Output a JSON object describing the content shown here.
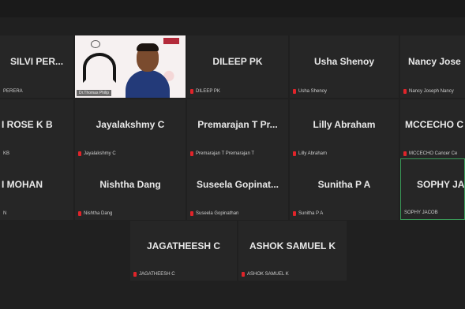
{
  "meeting": {
    "participants": [
      {
        "id": "silvi",
        "name": "SILVI PER...",
        "label": "PERERA"
      },
      {
        "id": "presenter",
        "name": "",
        "label": "Dr.Thomas Philip"
      },
      {
        "id": "dileep",
        "name": "DILEEP PK",
        "label": "DILEEP PK"
      },
      {
        "id": "usha",
        "name": "Usha Shenoy",
        "label": "Usha Shenoy"
      },
      {
        "id": "nancy",
        "name": "Nancy Jose",
        "label": "Nancy Joseph Nancy"
      },
      {
        "id": "rose",
        "name": "I ROSE K B",
        "label": "KB"
      },
      {
        "id": "jaya",
        "name": "Jayalakshmy C",
        "label": "Jayalakshmy C"
      },
      {
        "id": "prema",
        "name": "Premarajan T Pr...",
        "label": "Premarajan T Premarajan T"
      },
      {
        "id": "lilly",
        "name": "Lilly Abraham",
        "label": "Lilly Abraham"
      },
      {
        "id": "mccecho",
        "name": "MCCECHO C",
        "label": "MCCECHO Cancer Ce"
      },
      {
        "id": "mohan",
        "name": "I MOHAN",
        "label": "N"
      },
      {
        "id": "nishtha",
        "name": "Nishtha Dang",
        "label": "Nishtha Dang"
      },
      {
        "id": "suseela",
        "name": "Suseela  Gopinat...",
        "label": "Suseela Gopinathan"
      },
      {
        "id": "sunitha",
        "name": "Sunitha P A",
        "label": "Sunitha P A"
      },
      {
        "id": "sophy",
        "name": "SOPHY JA",
        "label": "SOPHY JACOB"
      },
      {
        "id": "jagatheesh",
        "name": "JAGATHEESH C",
        "label": "JAGATHEESH C"
      },
      {
        "id": "ashok",
        "name": "ASHOK SAMUEL K",
        "label": "ASHOK SAMUEL K"
      }
    ]
  },
  "colors": {
    "background": "#202020",
    "tile": "#262626",
    "active_speaker_border": "#3a9a58",
    "muted_mic": "#e0242a"
  },
  "icons": {
    "mic": "mic-muted-icon"
  }
}
